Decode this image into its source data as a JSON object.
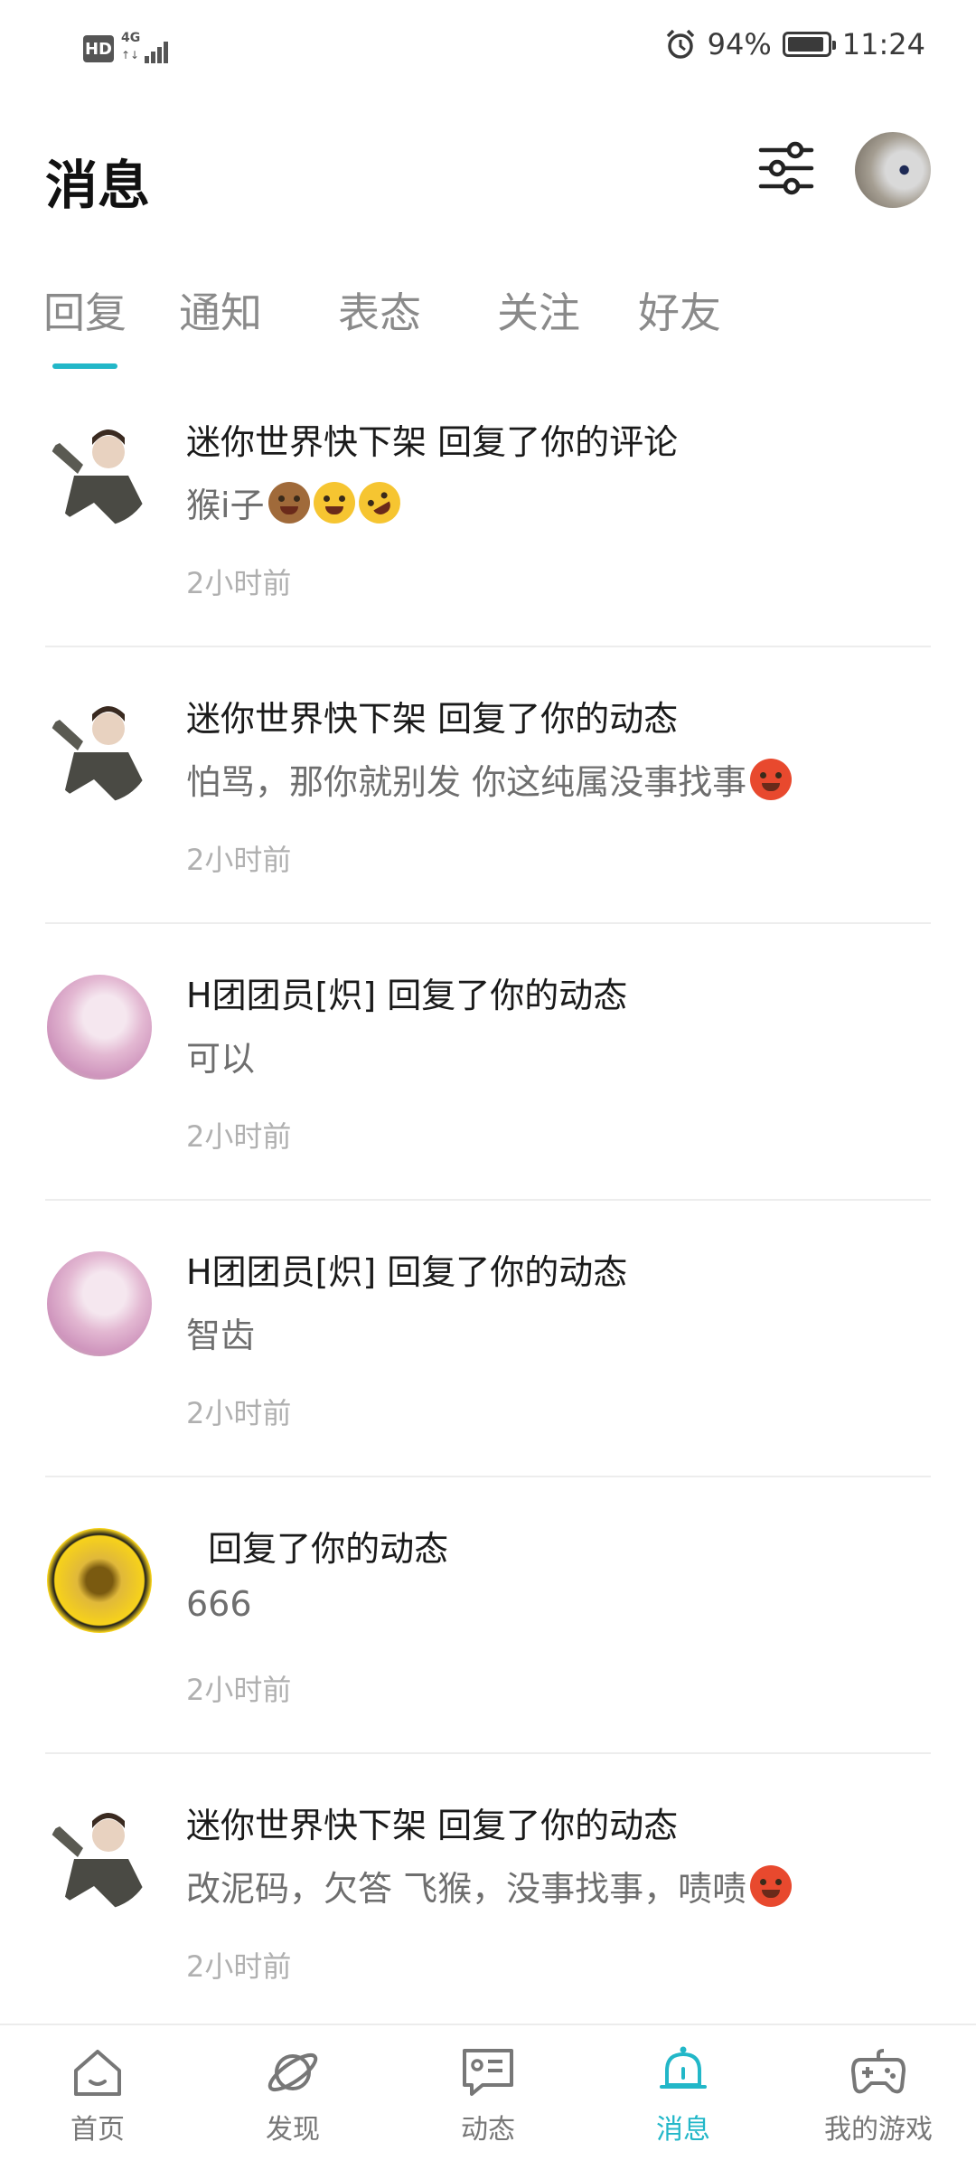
{
  "status_bar": {
    "hd": "HD",
    "network": "4G",
    "battery_percent": "94%",
    "battery_level": 0.94,
    "time": "11:24"
  },
  "header": {
    "title": "消息",
    "filter_icon": "filter-sliders-icon"
  },
  "tabs": [
    {
      "label": "回复",
      "active": true
    },
    {
      "label": "通知",
      "active": false
    },
    {
      "label": "表态",
      "active": false
    },
    {
      "label": "关注",
      "active": false
    },
    {
      "label": "好友",
      "active": false
    }
  ],
  "messages": [
    {
      "headline": "迷你世界快下架 回复了你的评论",
      "content": "猴i子",
      "emojis": [
        "monkey",
        "joy",
        "rofl"
      ],
      "time": "2小时前"
    },
    {
      "headline": "迷你世界快下架 回复了你的动态",
      "content": "怕骂，那你就别发 你这纯属没事找事",
      "emojis": [
        "hot"
      ],
      "time": "2小时前"
    },
    {
      "headline": "H团团员[炽] 回复了你的动态",
      "content": "可以",
      "emojis": [],
      "time": "2小时前"
    },
    {
      "headline": "H团团员[炽] 回复了你的动态",
      "content": "智齿",
      "emojis": [],
      "time": "2小时前"
    },
    {
      "headline": "  回复了你的动态",
      "content": "666",
      "emojis": [],
      "time": "2小时前"
    },
    {
      "headline": "迷你世界快下架 回复了你的动态",
      "content": "改泥码，欠答 飞猴，没事找事，啧啧",
      "emojis": [
        "hot"
      ],
      "time": "2小时前"
    }
  ],
  "bottom_nav": [
    {
      "label": "首页",
      "icon": "home-icon",
      "active": false
    },
    {
      "label": "发现",
      "icon": "planet-icon",
      "active": false
    },
    {
      "label": "动态",
      "icon": "chat-card-icon",
      "active": false
    },
    {
      "label": "消息",
      "icon": "bell-icon",
      "active": true
    },
    {
      "label": "我的游戏",
      "icon": "gamepad-icon",
      "active": false
    }
  ],
  "colors": {
    "accent": "#22b7c8",
    "text_primary": "#1a1a1a",
    "text_secondary": "#6e6e6e",
    "text_muted": "#b0b0b0"
  }
}
